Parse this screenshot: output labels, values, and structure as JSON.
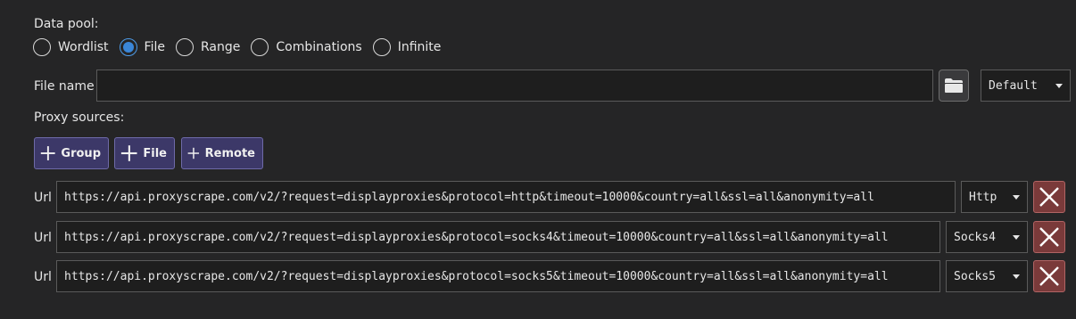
{
  "data_pool": {
    "label": "Data pool:",
    "options": [
      {
        "label": "Wordlist",
        "checked": false
      },
      {
        "label": "File",
        "checked": true
      },
      {
        "label": "Range",
        "checked": false
      },
      {
        "label": "Combinations",
        "checked": false
      },
      {
        "label": "Infinite",
        "checked": false
      }
    ]
  },
  "file_name": {
    "label": "File name",
    "value": "",
    "browse_icon": "folder-icon",
    "encoding": "Default"
  },
  "proxy_sources": {
    "label": "Proxy sources:",
    "buttons": {
      "group": "Group",
      "file": "File",
      "remote": "Remote"
    },
    "rows": [
      {
        "label": "Url",
        "url": "https://api.proxyscrape.com/v2/?request=displayproxies&protocol=http&timeout=10000&country=all&ssl=all&anonymity=all",
        "type": "Http"
      },
      {
        "label": "Url",
        "url": "https://api.proxyscrape.com/v2/?request=displayproxies&protocol=socks4&timeout=10000&country=all&ssl=all&anonymity=all",
        "type": "Socks4"
      },
      {
        "label": "Url",
        "url": "https://api.proxyscrape.com/v2/?request=displayproxies&protocol=socks5&timeout=10000&country=all&ssl=all&anonymity=all",
        "type": "Socks5"
      }
    ]
  },
  "colors": {
    "background": "#252526",
    "radio_accent": "#3a86d8",
    "add_button": "#3c3868",
    "delete_button": "#7a3a3a"
  }
}
